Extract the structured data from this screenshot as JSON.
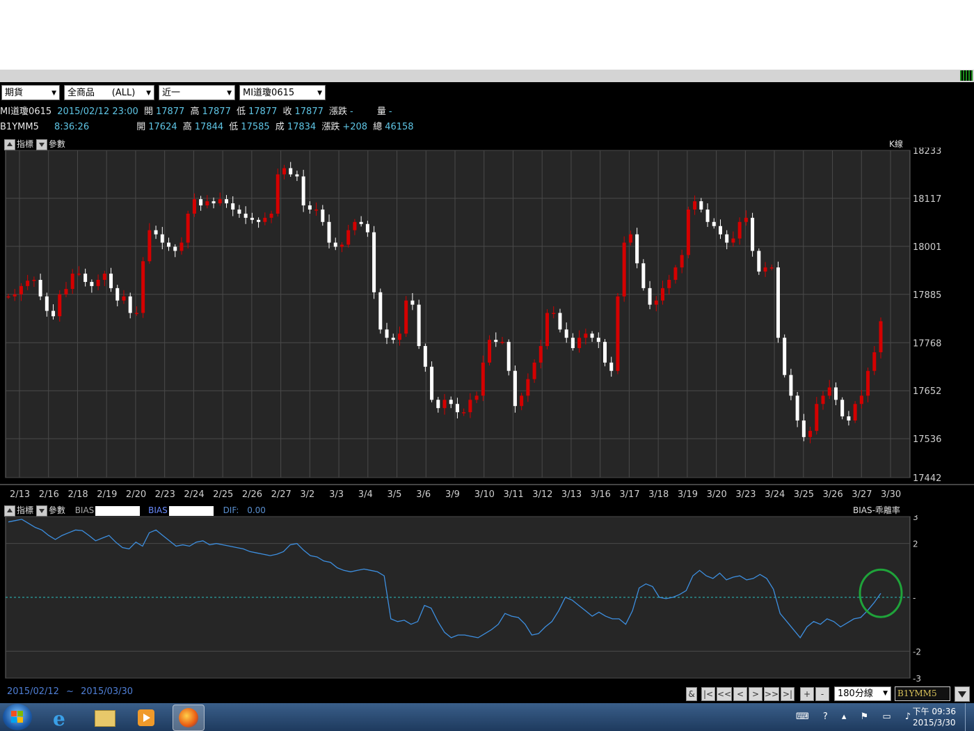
{
  "toolbar": {
    "combo1": "期貨",
    "combo2": "全商品      (ALL)",
    "combo3": "近一",
    "combo4": "MI道瓊0615"
  },
  "quote1": {
    "name": "MI道瓊0615",
    "datetime": "2015/02/12 23:00",
    "open_label": "開",
    "open": "17877",
    "high_label": "高",
    "high": "17877",
    "low_label": "低",
    "low": "17877",
    "close_label": "收",
    "close": "17877",
    "chg_label": "漲跌",
    "chg": "-",
    "vol_label": "量",
    "vol": "-"
  },
  "quote2": {
    "name": "B1YMM5",
    "time": "8:36:26",
    "open_label": "開",
    "open": "17624",
    "high_label": "高",
    "high": "17844",
    "low_label": "低",
    "low": "17585",
    "deal_label": "成",
    "deal": "17834",
    "chg_label": "漲跌",
    "chg": "+208",
    "total_label": "總",
    "total": "46158"
  },
  "panel1": {
    "indicator_label": "指標",
    "param_label": "參數",
    "type_label": "K線"
  },
  "panel2": {
    "indicator_label": "指標",
    "param_label": "參數",
    "bias1": "BIAS",
    "bias2": "BIAS",
    "dif_label": "DIF:",
    "dif_value": "0.00",
    "type_label": "BIAS-乖離率"
  },
  "date_range": {
    "from": "2015/02/12",
    "sep": "~",
    "to": "2015/03/30"
  },
  "nav": {
    "amp": "&",
    "first": "|<",
    "prev_page": "<<",
    "prev": "<",
    "next": ">",
    "next_page": ">>",
    "last": ">|",
    "zoom_in": "+",
    "zoom_out": "-",
    "period": "180分線",
    "symbol": "B1YMM5"
  },
  "tray": {
    "time": "下午 09:36",
    "date": "2015/3/30"
  },
  "colors": {
    "up": "#d40000",
    "down": "#ffffff",
    "bias_line": "#3d8fe0",
    "highlight_circle": "#1fa33a"
  },
  "chart_data": [
    {
      "type": "candlestick",
      "title": "K線",
      "ylim": [
        17442,
        18233
      ],
      "ytick_labels": [
        "18233",
        "18117",
        "18001",
        "17885",
        "17768",
        "17652",
        "17536",
        "17442"
      ],
      "xtick_labels": [
        "2/13",
        "2/16",
        "2/18",
        "2/19",
        "2/20",
        "2/23",
        "2/24",
        "2/25",
        "2/26",
        "2/27",
        "3/2",
        "3/3",
        "3/4",
        "3/5",
        "3/6",
        "3/9",
        "3/10",
        "3/11",
        "3/12",
        "3/13",
        "3/16",
        "3/17",
        "3/18",
        "3/19",
        "3/20",
        "3/23",
        "3/24",
        "3/25",
        "3/26",
        "3/27",
        "3/30"
      ],
      "close_series": [
        17880,
        17885,
        17905,
        17918,
        17920,
        17880,
        17845,
        17832,
        17885,
        17898,
        17935,
        17935,
        17915,
        17905,
        17920,
        17935,
        17900,
        17870,
        17880,
        17840,
        17840,
        17965,
        18040,
        18030,
        18010,
        18000,
        17990,
        18010,
        18080,
        18115,
        18100,
        18110,
        18105,
        18115,
        18105,
        18090,
        18080,
        18070,
        18065,
        18060,
        18070,
        18080,
        18175,
        18190,
        18175,
        18170,
        18100,
        18090,
        18090,
        18060,
        18010,
        18000,
        18005,
        18040,
        18060,
        18055,
        18035,
        17890,
        17800,
        17780,
        17775,
        17790,
        17870,
        17860,
        17760,
        17710,
        17630,
        17610,
        17630,
        17620,
        17600,
        17600,
        17630,
        17640,
        17720,
        17775,
        17770,
        17770,
        17700,
        17615,
        17640,
        17680,
        17720,
        17760,
        17840,
        17840,
        17800,
        17780,
        17755,
        17780,
        17790,
        17780,
        17770,
        17720,
        17700,
        17880,
        18010,
        18030,
        17960,
        17900,
        17860,
        17870,
        17900,
        17920,
        17950,
        17980,
        18090,
        18110,
        18090,
        18060,
        18050,
        18030,
        18010,
        18020,
        18060,
        18070,
        17990,
        17940,
        17950,
        17950,
        17780,
        17690,
        17640,
        17580,
        17540,
        17555,
        17620,
        17640,
        17660,
        17630,
        17590,
        17580,
        17620,
        17640,
        17700,
        17745,
        17820
      ]
    },
    {
      "type": "line",
      "title": "BIAS-乖離率",
      "ylim": [
        -3,
        3
      ],
      "ytick_labels": [
        "3",
        "2",
        "-",
        "-2",
        "-3"
      ],
      "series": [
        {
          "values": [
            2.8,
            2.85,
            2.9,
            2.75,
            2.6,
            2.5,
            2.3,
            2.15,
            2.3,
            2.4,
            2.5,
            2.48,
            2.3,
            2.1,
            2.2,
            2.3,
            2.05,
            1.85,
            1.8,
            2.05,
            1.9,
            2.4,
            2.5,
            2.3,
            2.1,
            1.9,
            1.95,
            1.9,
            2.05,
            2.1,
            1.95,
            2.0,
            1.95,
            1.9,
            1.85,
            1.8,
            1.7,
            1.65,
            1.6,
            1.55,
            1.6,
            1.7,
            1.95,
            2.0,
            1.75,
            1.55,
            1.5,
            1.35,
            1.3,
            1.1,
            1.0,
            0.95,
            1.0,
            1.05,
            1.0,
            0.95,
            0.8,
            -0.8,
            -0.9,
            -0.85,
            -1.0,
            -0.9,
            -0.3,
            -0.4,
            -0.9,
            -1.3,
            -1.5,
            -1.4,
            -1.4,
            -1.45,
            -1.5,
            -1.35,
            -1.2,
            -1.0,
            -0.6,
            -0.7,
            -0.75,
            -1.0,
            -1.4,
            -1.35,
            -1.1,
            -0.9,
            -0.5,
            0.0,
            -0.1,
            -0.3,
            -0.5,
            -0.7,
            -0.55,
            -0.7,
            -0.8,
            -0.8,
            -1.0,
            -0.5,
            0.35,
            0.5,
            0.4,
            0.0,
            -0.05,
            0.0,
            0.1,
            0.25,
            0.8,
            1.0,
            0.8,
            0.7,
            0.9,
            0.65,
            0.75,
            0.8,
            0.65,
            0.7,
            0.85,
            0.7,
            0.3,
            -0.6,
            -0.9,
            -1.2,
            -1.5,
            -1.1,
            -0.9,
            -1.0,
            -0.8,
            -0.9,
            -1.1,
            -0.95,
            -0.8,
            -0.75,
            -0.5,
            -0.2,
            0.15
          ]
        }
      ],
      "zero_line": true
    }
  ]
}
